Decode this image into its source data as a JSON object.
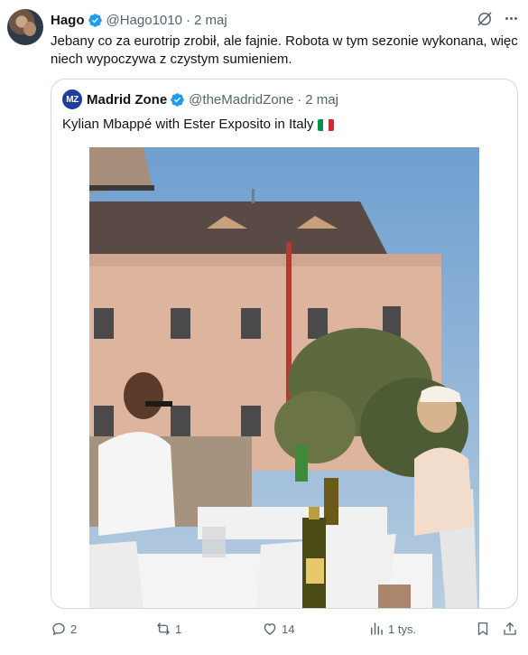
{
  "tweet": {
    "author_name": "Hago",
    "author_handle": "@Hago1010",
    "date": "2 maj",
    "text": "Jebany co za eurotrip zrobił, ale fajnie. Robota w tym sezonie wykonana, więc niech wypoczywa z czystym sumieniem."
  },
  "quote": {
    "avatar_text": "MZ",
    "author_name": "Madrid Zone",
    "author_handle": "@theMadridZone",
    "date": "2 maj",
    "text": "Kylian Mbappé with Ester Exposito in Italy",
    "flag_colors": [
      "#009246",
      "#ffffff",
      "#ce2b37"
    ]
  },
  "actions": {
    "replies": "2",
    "reposts": "1",
    "likes": "14",
    "views": "1 tys."
  },
  "colors": {
    "verified_blue": "#1d9bf0",
    "secondary_text": "#536471",
    "border": "#cfd9de"
  },
  "separator": "·"
}
